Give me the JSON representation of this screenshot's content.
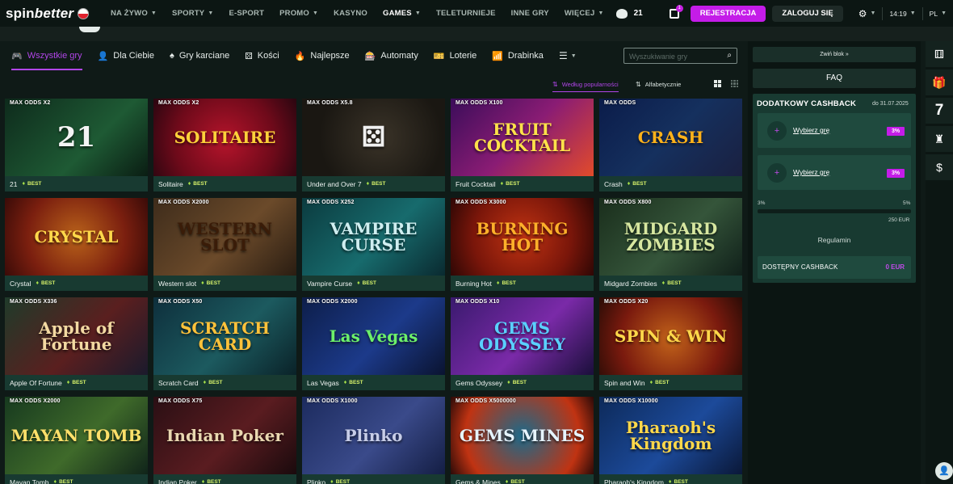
{
  "brand": {
    "logo_spin": "spin",
    "logo_better": "better"
  },
  "nav": {
    "items": [
      {
        "label": "NA ŻYWO",
        "chev": true,
        "active": false
      },
      {
        "label": "SPORTY",
        "chev": true,
        "active": false
      },
      {
        "label": "E-SPORT",
        "chev": false,
        "active": false
      },
      {
        "label": "PROMO",
        "chev": true,
        "active": false
      },
      {
        "label": "KASYNO",
        "chev": false,
        "active": false
      },
      {
        "label": "GAMES",
        "chev": true,
        "active": true
      },
      {
        "label": "TELETURNIEJE",
        "chev": false,
        "active": false
      },
      {
        "label": "INNE GRY",
        "chev": false,
        "active": false
      },
      {
        "label": "WIĘCEJ",
        "chev": true,
        "active": false
      }
    ],
    "counter": "21"
  },
  "header": {
    "gift_badge": "1",
    "register_label": "REJESTRACJA",
    "login_label": "ZALOGUJ SIĘ",
    "time": "14:19",
    "lang": "PL"
  },
  "categories": [
    {
      "label": "Wszystkie gry",
      "icon": "gamepad-icon",
      "glyph": "🎮",
      "active": true
    },
    {
      "label": "Dla Ciebie",
      "icon": "user-icon",
      "glyph": "👤",
      "active": false
    },
    {
      "label": "Gry karciane",
      "icon": "spade-icon",
      "glyph": "♠",
      "active": false
    },
    {
      "label": "Kości",
      "icon": "dice-icon",
      "glyph": "⚄",
      "active": false
    },
    {
      "label": "Najlepsze",
      "icon": "fire-icon",
      "glyph": "🔥",
      "active": false
    },
    {
      "label": "Automaty",
      "icon": "slot-icon",
      "glyph": "🎰",
      "active": false
    },
    {
      "label": "Loterie",
      "icon": "ticket-icon",
      "glyph": "🎫",
      "active": false
    },
    {
      "label": "Drabinka",
      "icon": "chart-icon",
      "glyph": "📶",
      "active": false
    }
  ],
  "search": {
    "placeholder": "Wyszukiwanie gry"
  },
  "sort": {
    "popular": "Według popularności",
    "alpha": "Alfabetycznie"
  },
  "best_label": "BEST",
  "games": [
    {
      "name": "21",
      "odds": "MAX ODDS X2",
      "art": "21",
      "bg": "linear-gradient(135deg,#0e2b1c,#1e5a34 60%,#0a1d13)",
      "fg": "#f4f4f4"
    },
    {
      "name": "Solitaire",
      "odds": "MAX ODDS X2",
      "art": "SOLITAIRE",
      "bg": "radial-gradient(circle at 50% 55%,#b5142b,#6e0a1a 60%,#2a0610)",
      "fg": "#ffd23a"
    },
    {
      "name": "Under and Over 7",
      "odds": "MAX ODDS X5.8",
      "art": "⚄",
      "bg": "radial-gradient(circle at 55% 50%,#3a3328,#1a1712 70%)",
      "fg": "#f0f0f0"
    },
    {
      "name": "Fruit Cocktail",
      "odds": "MAX ODDS X100",
      "art": "FRUIT COCKTAIL",
      "bg": "linear-gradient(135deg,#3b0d5a,#8a1c74 50%,#e24b2a)",
      "fg": "#ffe24a"
    },
    {
      "name": "Crash",
      "odds": "MAX ODDS",
      "art": "CRASH",
      "bg": "linear-gradient(135deg,#0b1c4a,#15305e 50%,#1a2040)",
      "fg": "#ffb21a"
    },
    {
      "name": "Crystal",
      "odds": "",
      "art": "CRYSTAL",
      "bg": "radial-gradient(circle at 50% 50%,#b9621a,#7b1f0f 60%,#3a0b08)",
      "fg": "#ffd84a"
    },
    {
      "name": "Western slot",
      "odds": "MAX ODDS X2000",
      "art": "WESTERN SLOT",
      "bg": "linear-gradient(135deg,#3e2c1b,#6b4a2a 55%,#2a1d12)",
      "fg": "#3a1c08"
    },
    {
      "name": "Vampire Curse",
      "odds": "MAX ODDS X252",
      "art": "VAMPIRE CURSE",
      "bg": "linear-gradient(135deg,#0b3b3f,#176b6d 55%,#0a2a30)",
      "fg": "#cfeef0"
    },
    {
      "name": "Burning Hot",
      "odds": "MAX ODDS X3000",
      "art": "BURNING HOT",
      "bg": "radial-gradient(circle at 50% 50%,#c03312,#7a160a 60%,#2e0705)",
      "fg": "#ffb02a"
    },
    {
      "name": "Midgard Zombies",
      "odds": "MAX ODDS X800",
      "art": "MIDGARD ZOMBIES",
      "bg": "linear-gradient(135deg,#1a2e1c,#35553a 55%,#10201a)",
      "fg": "#d7e7a0"
    },
    {
      "name": "Apple Of Fortune",
      "odds": "MAX ODDS X336",
      "art": "Apple of Fortune",
      "bg": "linear-gradient(135deg,#1f3b2a,#5a1f1f 55%,#1a1a2c)",
      "fg": "#f3d9a2"
    },
    {
      "name": "Scratch Card",
      "odds": "MAX ODDS X50",
      "art": "SCRATCH CARD",
      "bg": "linear-gradient(135deg,#0e2f3c,#1c5a5f 55%,#0a2228)",
      "fg": "#ffc23a"
    },
    {
      "name": "Las Vegas",
      "odds": "MAX ODDS X2000",
      "art": "Las Vegas",
      "bg": "linear-gradient(135deg,#0d1e4a,#1c3a8a 55%,#0a1330)",
      "fg": "#6cf06a"
    },
    {
      "name": "Gems Odyssey",
      "odds": "MAX ODDS X10",
      "art": "GEMS ODYSSEY",
      "bg": "linear-gradient(135deg,#3a1a6e,#7a2aa8 55%,#1a0f3a)",
      "fg": "#5ad0ff"
    },
    {
      "name": "Spin and Win",
      "odds": "MAX ODDS X20",
      "art": "SPIN & WIN",
      "bg": "radial-gradient(circle at 50% 55%,#c2631a,#7a1a0e 60%,#2a0c06)",
      "fg": "#ffd84a"
    },
    {
      "name": "Mayan Tomb",
      "odds": "MAX ODDS X2000",
      "art": "MAYAN TOMB",
      "bg": "linear-gradient(135deg,#173a1f,#3f6a2a 55%,#10241a)",
      "fg": "#ffe06a"
    },
    {
      "name": "Indian Poker",
      "odds": "MAX ODDS X75",
      "art": "Indian Poker",
      "bg": "linear-gradient(135deg,#2a0f14,#5a1c20 55%,#1a0a0d)",
      "fg": "#e9d7b0"
    },
    {
      "name": "Plinko",
      "odds": "MAX ODDS X1000",
      "art": "Plinko",
      "bg": "linear-gradient(135deg,#1c2b5e,#3a4a8a 55%,#141e44)",
      "fg": "#c7cde8"
    },
    {
      "name": "Gems & Mines",
      "odds": "MAX ODDS X5000000",
      "art": "GEMS MINES",
      "bg": "radial-gradient(circle at 50% 50%,#1c6a8a,#c03312 70%,#2a0a08)",
      "fg": "#e6f4ff"
    },
    {
      "name": "Pharaoh's Kingdom",
      "odds": "MAX ODDS X10000",
      "art": "Pharaoh's Kingdom",
      "bg": "linear-gradient(135deg,#0d2a5a,#1c4a9a 55%,#0a1838)",
      "fg": "#ffd84a"
    }
  ],
  "panel": {
    "collapse_label": "Zwiń blok",
    "faq_label": "FAQ",
    "cashback_title": "DODATKOWY CASHBACK",
    "cashback_date": "do 31.07.2025",
    "slots": [
      {
        "label": "Wybierz grę",
        "pct": "3%"
      },
      {
        "label": "Wybierz grę",
        "pct": "3%"
      }
    ],
    "progress_min": "3%",
    "progress_max": "5%",
    "progress_fraction": 0.0,
    "progress_target": "250 EUR",
    "regulamin": "Regulamin",
    "available_label": "DOSTĘPNY CASHBACK",
    "available_value": "0 EUR"
  },
  "side_icons": [
    {
      "name": "dice-side-icon",
      "glyph": "⚅"
    },
    {
      "name": "gift-side-icon",
      "glyph": "🎁"
    },
    {
      "name": "seven-side-icon",
      "glyph": "7"
    },
    {
      "name": "trophy-side-icon",
      "glyph": "♜"
    },
    {
      "name": "dollar-side-icon",
      "glyph": "$"
    }
  ]
}
